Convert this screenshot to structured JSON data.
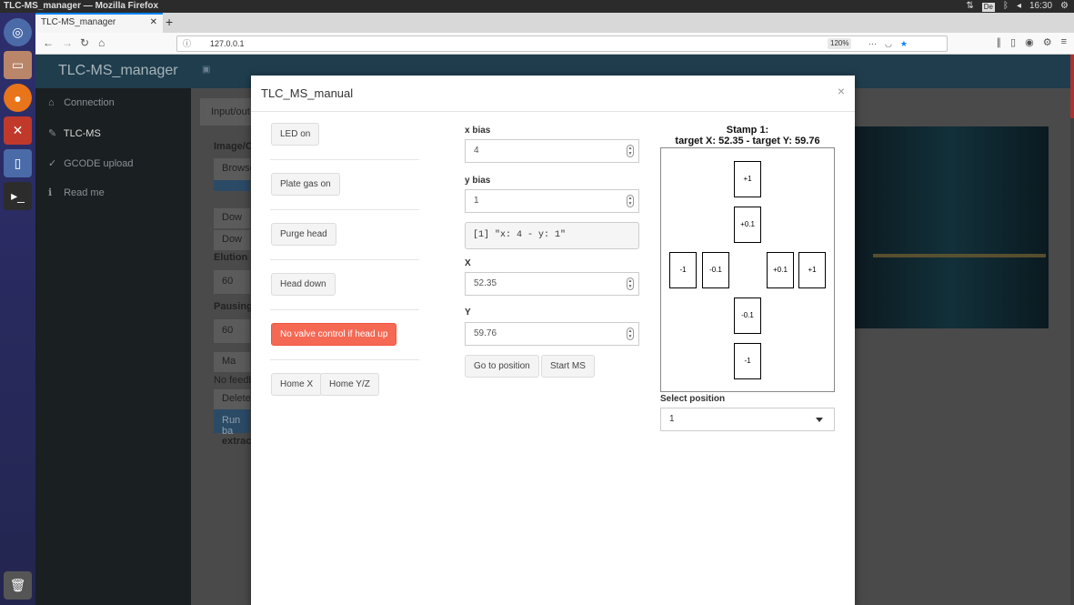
{
  "os": {
    "window_title": "TLC-MS_manager — Mozilla Firefox",
    "keyboard_layout": "De",
    "time": "16:30"
  },
  "browser": {
    "tab_title": "TLC-MS_manager",
    "url": "127.0.0.1",
    "zoom": "120%"
  },
  "app": {
    "brand": "TLC-MS_manager",
    "sidebar": [
      {
        "label": "Connection",
        "icon": "home-icon"
      },
      {
        "label": "TLC-MS",
        "icon": "pin-icon"
      },
      {
        "label": "GCODE upload",
        "icon": "wrench-icon"
      },
      {
        "label": "Read me",
        "icon": "info-icon"
      }
    ],
    "background": {
      "tab_label": "Input/out",
      "image_label": "Image/C",
      "browse": "Browse",
      "download1": "Dow",
      "download2": "Dow",
      "elution_label": "Elution [",
      "elution_value": "60",
      "pausing_label": "Pausing",
      "pausing_value": "60",
      "manual": "Ma",
      "no_feedback": "No feedb",
      "delete": "Delete",
      "run": "Run ba",
      "extract": "extract"
    }
  },
  "modal": {
    "title": "TLC_MS_manual",
    "close": "×",
    "buttons": {
      "led_on": "LED on",
      "plate_gas_on": "Plate gas on",
      "purge_head": "Purge head",
      "head_down": "Head down",
      "no_valve": "No valve control if head up",
      "home_x": "Home X",
      "home_yz": "Home Y/Z",
      "go_to_position": "Go to position",
      "start_ms": "Start MS"
    },
    "x_bias": {
      "label": "x bias",
      "value": "4"
    },
    "y_bias": {
      "label": "y bias",
      "value": "1"
    },
    "bias_output": "[1] \"x: 4 - y: 1\"",
    "x": {
      "label": "X",
      "value": "52.35"
    },
    "y": {
      "label": "Y",
      "value": "59.76"
    },
    "stamp": {
      "title_line1": "Stamp 1:",
      "title_line2": "target X: 52.35 - target Y: 59.76",
      "up1": "+1",
      "up01": "+0.1",
      "left1": "-1",
      "left01": "-0.1",
      "right01": "+0.1",
      "right1": "+1",
      "down01": "-0.1",
      "down1": "-1"
    },
    "select_position": {
      "label": "Select position",
      "value": "1"
    }
  }
}
